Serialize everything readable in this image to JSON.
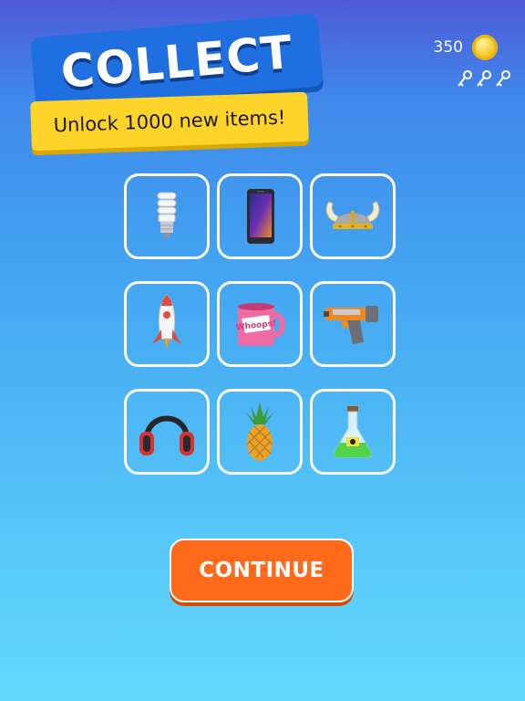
{
  "header": {
    "title": "COLLECT",
    "subtitle": "Unlock 1000 new items!"
  },
  "wallet": {
    "coins": "350",
    "coin_icon": "coin-icon",
    "keys": [
      "key-icon",
      "key-icon",
      "key-icon"
    ]
  },
  "items": [
    {
      "icon": "light-bulb-icon"
    },
    {
      "icon": "smartphone-icon"
    },
    {
      "icon": "viking-helmet-icon"
    },
    {
      "icon": "rocket-icon"
    },
    {
      "icon": "mug-icon",
      "text": "Whoops!"
    },
    {
      "icon": "toy-blaster-icon"
    },
    {
      "icon": "headphones-icon"
    },
    {
      "icon": "pineapple-icon"
    },
    {
      "icon": "potion-flask-icon"
    }
  ],
  "continue_button": {
    "label": "CONTINUE"
  },
  "colors": {
    "title_banner": "#1f6fe0",
    "subtitle_banner": "#ffd42a",
    "button": "#ff6a1a"
  }
}
